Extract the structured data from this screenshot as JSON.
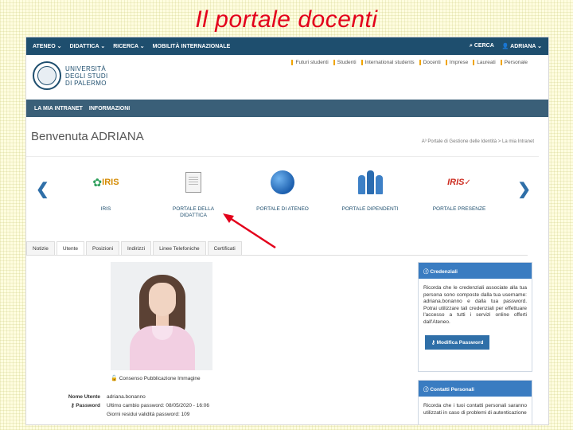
{
  "slide_title": "Il portale docenti",
  "topnav": {
    "items": [
      "ATENEO ⌄",
      "DIDATTICA ⌄",
      "RICERCA ⌄",
      "MOBILITÀ INTERNAZIONALE"
    ],
    "search": "CERCA",
    "user": "ADRIANA ⌄"
  },
  "logo": {
    "line1": "UNIVERSITÀ",
    "line2": "DEGLI STUDI",
    "line3": "DI PALERMO"
  },
  "quicklinks": [
    "Futuri studenti",
    "Studenti",
    "International students",
    "Docenti",
    "Imprese",
    "Laureati",
    "Personale"
  ],
  "intranet_bar": [
    "LA MIA INTRANET",
    "INFORMAZIONI"
  ],
  "welcome": "Benvenuta ADRIANA",
  "breadcrumb": "A³ Portale di Gestione delle Identità > La mia Intranet",
  "carousel": {
    "tiles": [
      {
        "label": "IRIS",
        "icon": "iris-icon"
      },
      {
        "label": "PORTALE DELLA DIDATTICA",
        "icon": "document-icon"
      },
      {
        "label": "PORTALE DI ATENEO",
        "icon": "globe-icon"
      },
      {
        "label": "PORTALE DIPENDENTI",
        "icon": "people-icon"
      },
      {
        "label": "PORTALE PRESENZE",
        "icon": "iris-presenze-icon"
      }
    ],
    "iris_mark": "IRIS"
  },
  "tabs": [
    "Notizie",
    "Utente",
    "Posizioni",
    "Indirizzi",
    "Linee Telefoniche",
    "Certificati"
  ],
  "active_tab": "Utente",
  "consent": "Consenso Pubblicazione Immagine",
  "userinfo": {
    "name_label": "Nome Utente",
    "name_value": "adriana.bonanno",
    "password_label": "Password",
    "last_change": "Ultimo cambio password: 08/05/2020 - 16:06",
    "days_left": "Giorni residui validità password: 109"
  },
  "credentials_panel": {
    "title": "Credenziali",
    "body": "Ricorda che le credenziali associate alla tua persona sono composte dalla tua username: adriana.bonanno e dalla tua password. Potrai utilizzare tali credenziali per effettuare l'accesso a tutti i servizi online offerti dall'Ateneo.",
    "button": "Modifica Password"
  },
  "contacts_panel": {
    "title": "Contatti Personali",
    "body": "Ricorda che i tuoi contatti personali saranno utilizzati in caso di problemi di autenticazione"
  },
  "colors": {
    "title_red": "#e3001b",
    "nav": "#1e4e6e",
    "accent": "#3a7cc1",
    "arrow": "#e3001b"
  }
}
